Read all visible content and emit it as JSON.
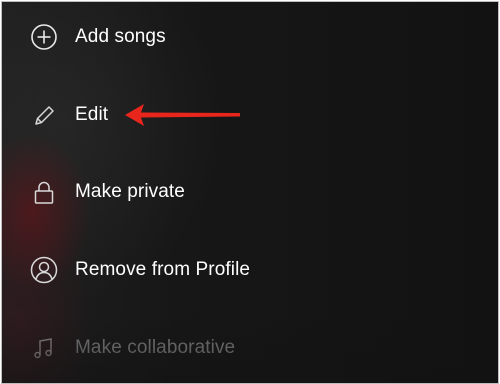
{
  "menu": {
    "items": [
      {
        "label": "Add songs",
        "icon": "plus-circle-icon"
      },
      {
        "label": "Edit",
        "icon": "pencil-icon"
      },
      {
        "label": "Make private",
        "icon": "lock-icon"
      },
      {
        "label": "Remove from Profile",
        "icon": "user-circle-icon"
      },
      {
        "label": "Make collaborative",
        "icon": "music-note-icon"
      }
    ]
  },
  "annotation": {
    "icon": "red-arrow-icon",
    "color": "#e8261c",
    "points_to": "Edit"
  },
  "colors": {
    "background": "#121212",
    "text": "#ffffff",
    "text_faded": "#7d7d7d",
    "arrow": "#e8261c"
  }
}
